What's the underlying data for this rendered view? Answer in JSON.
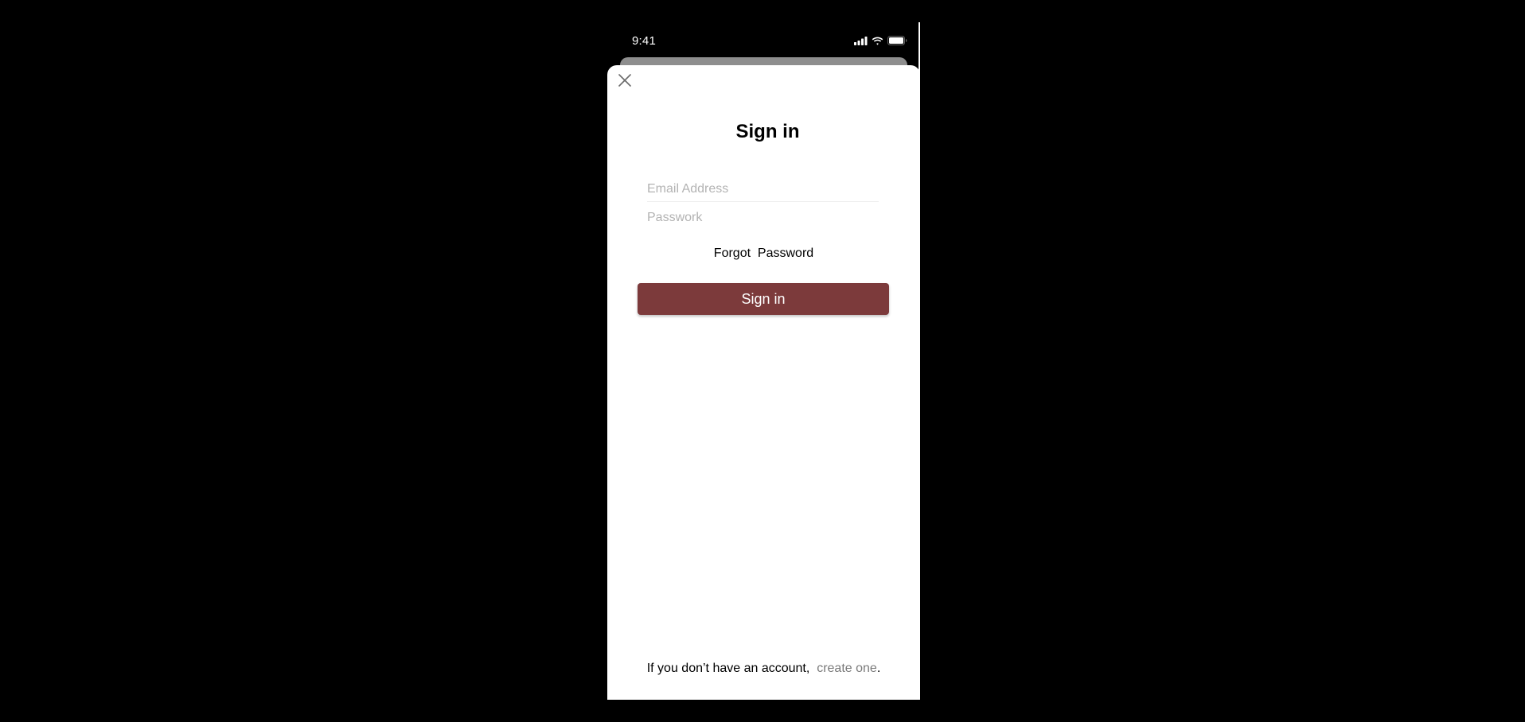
{
  "status_bar": {
    "time": "9:41",
    "icons": [
      "cellular-signal-icon",
      "wifi-icon",
      "battery-icon"
    ]
  },
  "sheet": {
    "close_icon": "close-icon",
    "title": "Sign in",
    "email": {
      "placeholder": "Email Address",
      "value": ""
    },
    "password": {
      "placeholder": "Passwork",
      "value": ""
    },
    "forgot_password_label": "Forgot  Password",
    "signin_button_label": "Sign in",
    "footer": {
      "prefix": "If you don’t have an account,  ",
      "link_label": "create one",
      "suffix": "."
    }
  },
  "colors": {
    "background": "#000000",
    "sheet": "#ffffff",
    "accent": "#7c3a3b",
    "placeholder": "#b3b3b3",
    "link": "#7a7a7a"
  }
}
